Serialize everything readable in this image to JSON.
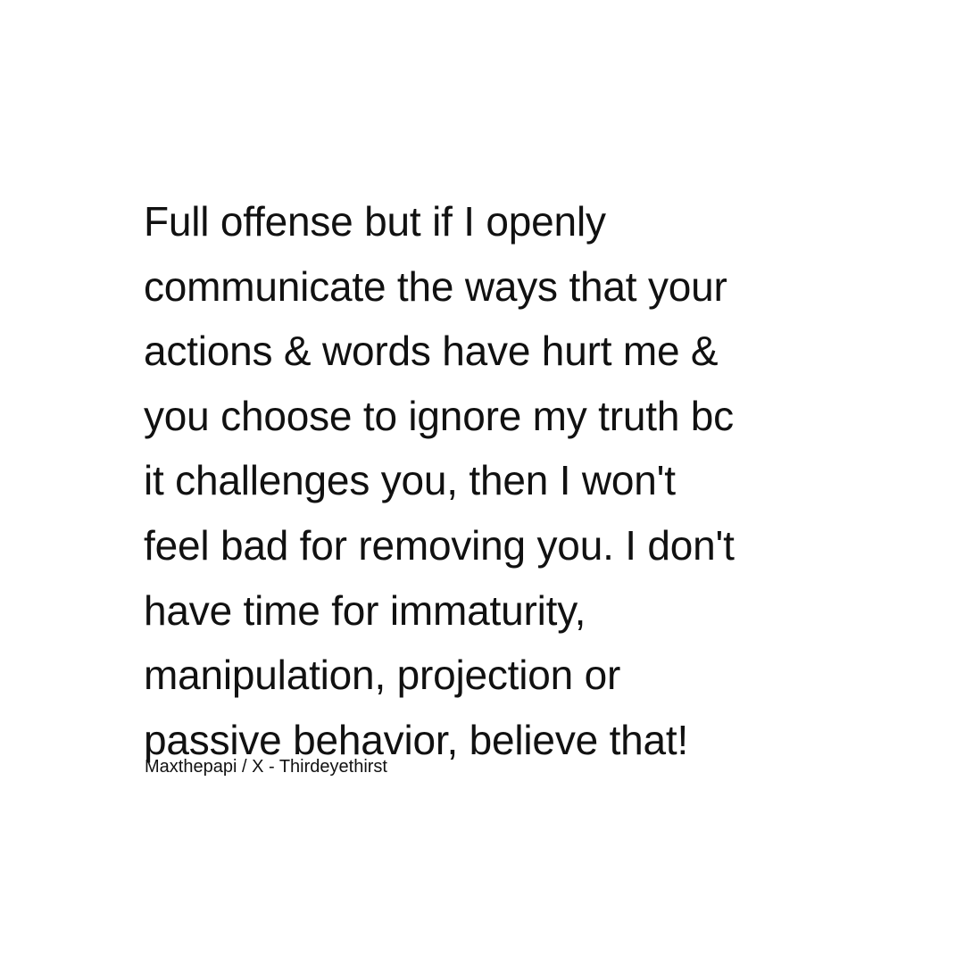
{
  "quote": {
    "lines": [
      "Full offense but if I openly",
      "communicate the ways that your",
      "actions & words have hurt me &",
      "you choose to ignore my truth bc",
      "it challenges you, then I won't",
      "feel bad for removing you. I don't",
      "have time for immaturity,",
      "manipulation, projection or",
      "passive behavior, believe that!"
    ]
  },
  "attribution": "Maxthepapi / X - Thirdeyethirst",
  "colors": {
    "background": "#ffffff",
    "text": "#111111"
  }
}
